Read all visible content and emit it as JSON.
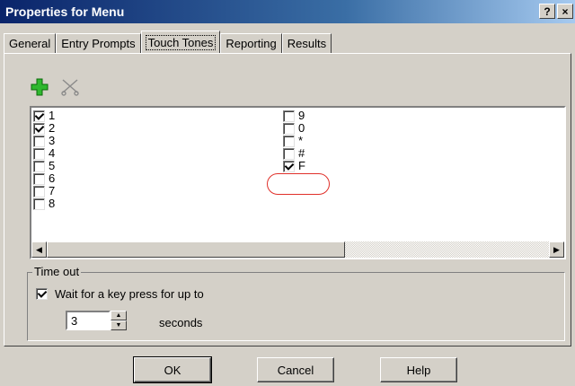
{
  "window": {
    "title": "Properties for Menu",
    "help_btn": "?",
    "close_btn": "×"
  },
  "tabs": [
    {
      "label": "General"
    },
    {
      "label": "Entry Prompts"
    },
    {
      "label": "Touch Tones",
      "active": true
    },
    {
      "label": "Reporting"
    },
    {
      "label": "Results"
    }
  ],
  "toolbar": {
    "add_icon": "plus-icon",
    "delete_icon": "scissors-icon"
  },
  "tones_col1": [
    {
      "label": "1",
      "checked": true
    },
    {
      "label": "2",
      "checked": true
    },
    {
      "label": "3",
      "checked": false
    },
    {
      "label": "4",
      "checked": false
    },
    {
      "label": "5",
      "checked": false
    },
    {
      "label": "6",
      "checked": false
    },
    {
      "label": "7",
      "checked": false
    },
    {
      "label": "8",
      "checked": false
    }
  ],
  "tones_col2": [
    {
      "label": "9",
      "checked": false
    },
    {
      "label": "0",
      "checked": false
    },
    {
      "label": "*",
      "checked": false
    },
    {
      "label": "#",
      "checked": false
    },
    {
      "label": "F",
      "checked": true
    }
  ],
  "timeout": {
    "group_label": "Time out",
    "wait_label": "Wait for a key press for up to",
    "wait_checked": true,
    "value": "3",
    "unit": "seconds"
  },
  "buttons": {
    "ok": "OK",
    "cancel": "Cancel",
    "help": "Help"
  },
  "colors": {
    "title_start": "#0a246a",
    "highlight": "#e0302a"
  }
}
